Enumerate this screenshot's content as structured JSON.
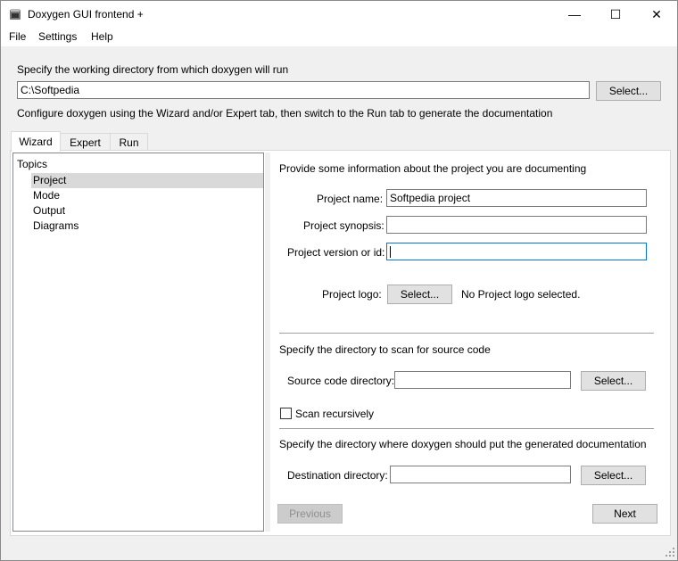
{
  "window": {
    "title": "Doxygen GUI frontend +",
    "minimize": "—",
    "maximize": "☐",
    "close": "✕"
  },
  "menu": [
    "File",
    "Settings",
    "Help"
  ],
  "working_dir": {
    "label": "Specify the working directory from which doxygen will run",
    "value": "C:\\Softpedia",
    "select_label": "Select..."
  },
  "configure_hint": "Configure doxygen using the Wizard and/or Expert tab, then switch to the Run tab to generate the documentation",
  "tabs": [
    "Wizard",
    "Expert",
    "Run"
  ],
  "topics": {
    "header": "Topics",
    "items": [
      "Project",
      "Mode",
      "Output",
      "Diagrams"
    ],
    "selected": "Project"
  },
  "project": {
    "intro": "Provide some information about the project you are documenting",
    "name_label": "Project name:",
    "name_value": "Softpedia project",
    "synopsis_label": "Project synopsis:",
    "synopsis_value": "",
    "version_label": "Project version or id:",
    "version_value": "",
    "logo_label": "Project logo:",
    "logo_button": "Select...",
    "logo_status": "No Project logo selected."
  },
  "source": {
    "intro": "Specify the directory to scan for source code",
    "dir_label": "Source code directory:",
    "dir_value": "",
    "select_label": "Select...",
    "recursive_label": "Scan recursively",
    "recursive_checked": false
  },
  "destination": {
    "intro": "Specify the directory where doxygen should put the generated documentation",
    "dir_label": "Destination directory:",
    "dir_value": "",
    "select_label": "Select..."
  },
  "nav": {
    "previous": "Previous",
    "next": "Next"
  }
}
